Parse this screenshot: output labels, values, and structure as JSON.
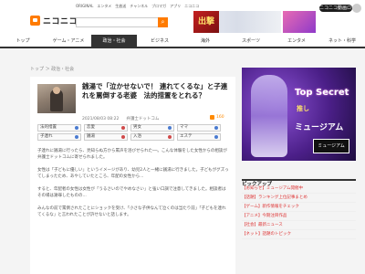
{
  "header": {
    "logo": "ニコニコニュース",
    "top_links": [
      "ORIGINAL",
      "エンタメ",
      "生放送",
      "チャンネル",
      "ブロマガ",
      "アプリ",
      "ニコニコ"
    ],
    "banner_text": "出撃",
    "login_label": "ニコニコ動画ログイン"
  },
  "nav": {
    "items": [
      "トップ",
      "ゲーム・アニメ",
      "政治・社会",
      "ビジネス",
      "海外",
      "スポーツ",
      "エンタメ",
      "ネット・科学"
    ],
    "active_index": 2
  },
  "breadcrumb": "トップ ＞ 政治・社会",
  "article": {
    "title": "銭湯で「泣かせないで！ 連れてくるな」と子連れを罵倒する老婆　法的措置をとれる？",
    "date": "2021/08/03 08:22",
    "source": "弁護士ドットコム",
    "likes": "160",
    "tags": [
      [
        "法的措置",
        "恋愛",
        "男女",
        "ママ",
        "エステ"
      ],
      [
        "子連れ",
        "銭湯",
        "入浴"
      ]
    ],
    "paragraphs": [
      "子連れに銭湯に行ったら、見知らぬ方から罵声を浴びせられた──。こんな体験をした女性からの相談が弁護士ドットコムに寄せられました。",
      "女性は「子どもに優しい」というイメージがあり、幼児2人と一緒に銭湯に行きました。子どもがグズってしまったため、あやしていたところ、年配の女性から...",
      "すると、年配者の女性は女性が「うるさいのでやめなさい」と強い口調で注意してきました。相談者はその場は謝罪したものの...",
      "みんなの前で罵倒されたことにショックを受け、「小さな子供なんて泣くのは当たり前」「子どもを連れてくるな」と言われたことが許せないと話します。"
    ]
  },
  "sidebar": {
    "ad_title": "Top Secret",
    "ad_sub": "推し",
    "ad_main": "ミュージアム",
    "ad_badge": "ミュージアム",
    "pickup_title": "ピックアップ",
    "pickup_items": [
      "【お知らせ】ミュージアム開催中",
      "【話題】ランキング上位記事まとめ",
      "【ゲーム】新作情報をチェック",
      "【アニメ】今期注目作品",
      "【社会】最新ニュース",
      "【ネット】話題のトピック"
    ]
  },
  "colors": {
    "accent": "#ff7b00",
    "nav_active": "#333333",
    "pickup": "#dd3333"
  }
}
